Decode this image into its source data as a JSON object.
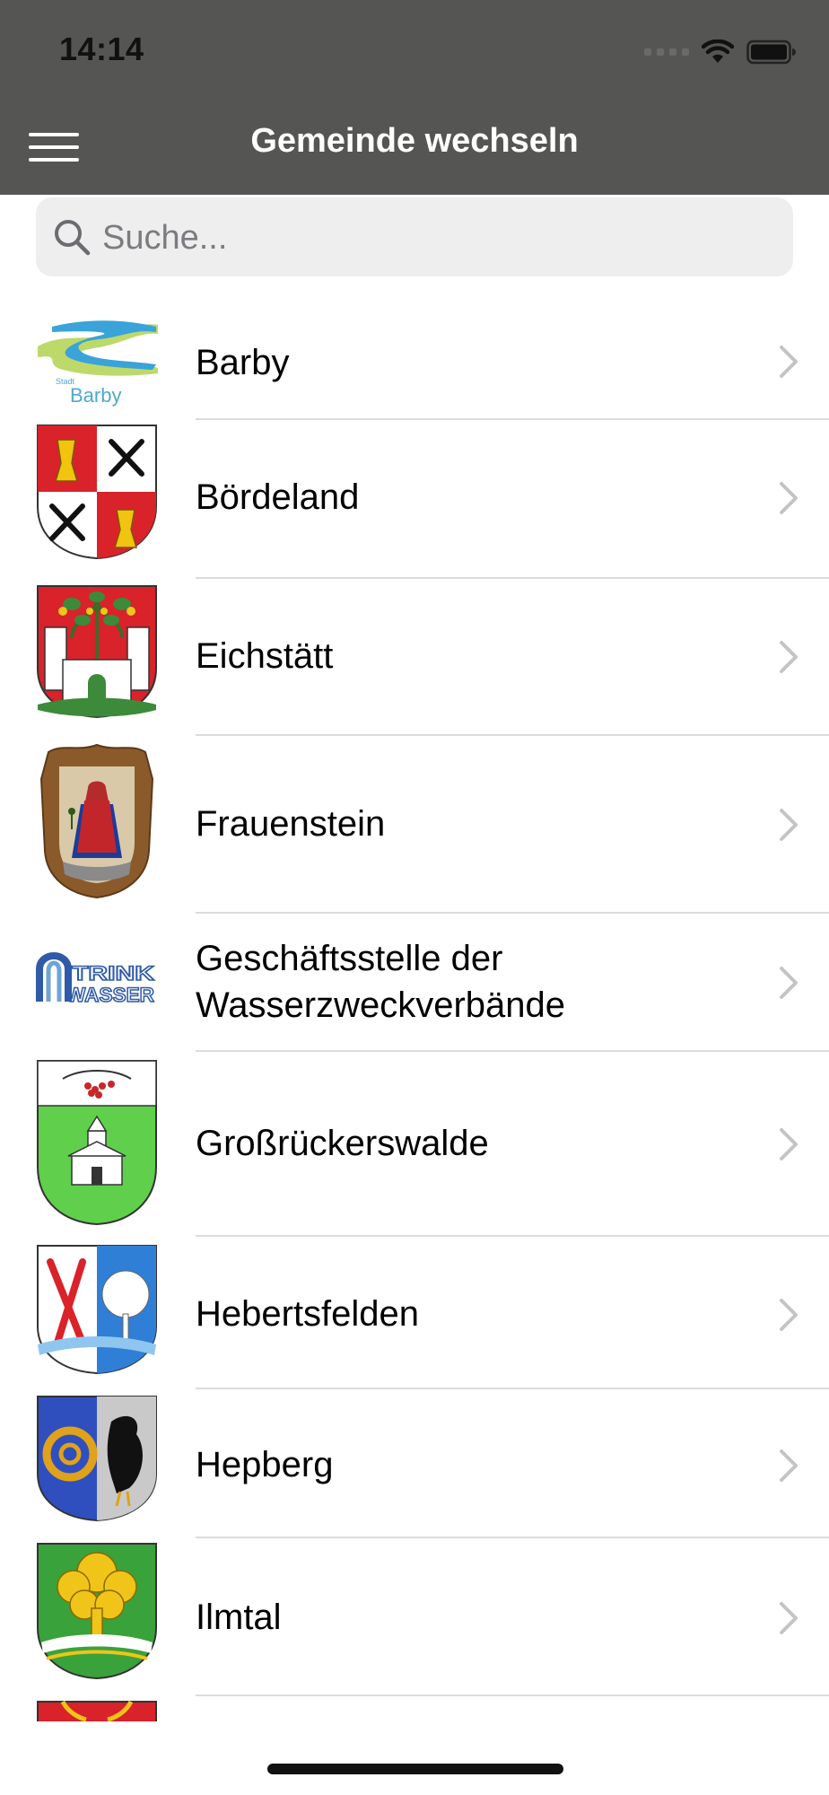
{
  "status_bar": {
    "time": "14:14"
  },
  "header": {
    "title": "Gemeinde wechseln",
    "menu_icon": "hamburger-menu-icon"
  },
  "search": {
    "placeholder": "Suche...",
    "value": ""
  },
  "colors": {
    "header_background": "#555554",
    "search_background": "#eeeeef",
    "divider": "#dcdcde",
    "chevron": "#c4c4c7"
  },
  "communities": [
    {
      "name": "Barby",
      "logo_caption_small": "Stadt",
      "logo_caption": "Barby"
    },
    {
      "name": "Bördeland"
    },
    {
      "name": "Eichstätt"
    },
    {
      "name": "Frauenstein"
    },
    {
      "name_line1": "Geschäftsstelle der",
      "name_line2": "Wasserzweckverbände",
      "logo_text_line1": "TRINK",
      "logo_text_line2": "WASSER"
    },
    {
      "name": "Großrückerswalde"
    },
    {
      "name": "Hebertsfelden"
    },
    {
      "name": "Hepberg"
    },
    {
      "name": "Ilmtal"
    }
  ]
}
